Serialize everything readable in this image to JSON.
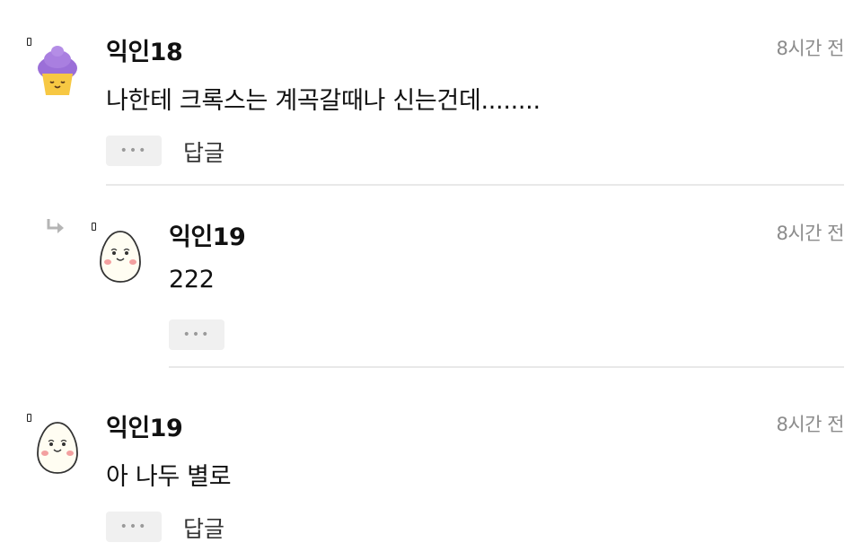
{
  "comments": [
    {
      "author": "익인18",
      "time": "8시간 전",
      "text": "나한테 크록스는 계곡갈때나 신는건데........",
      "more_label": "•••",
      "reply_label": "답글",
      "avatar": "cupcake-avatar"
    },
    {
      "author": "익인19",
      "time": "8시간 전",
      "text": "222",
      "more_label": "•••",
      "is_reply": true,
      "avatar": "egg-avatar"
    },
    {
      "author": "익인19",
      "time": "8시간 전",
      "text": "아 나두 별로",
      "more_label": "•••",
      "reply_label": "답글",
      "avatar": "egg-avatar"
    }
  ],
  "colors": {
    "time": "#8c8c8c",
    "button_bg": "#f0f0f0",
    "divider": "#e8e8e8",
    "cupcake_frosting": "#9b6fd8",
    "cupcake_base": "#f7c843"
  }
}
